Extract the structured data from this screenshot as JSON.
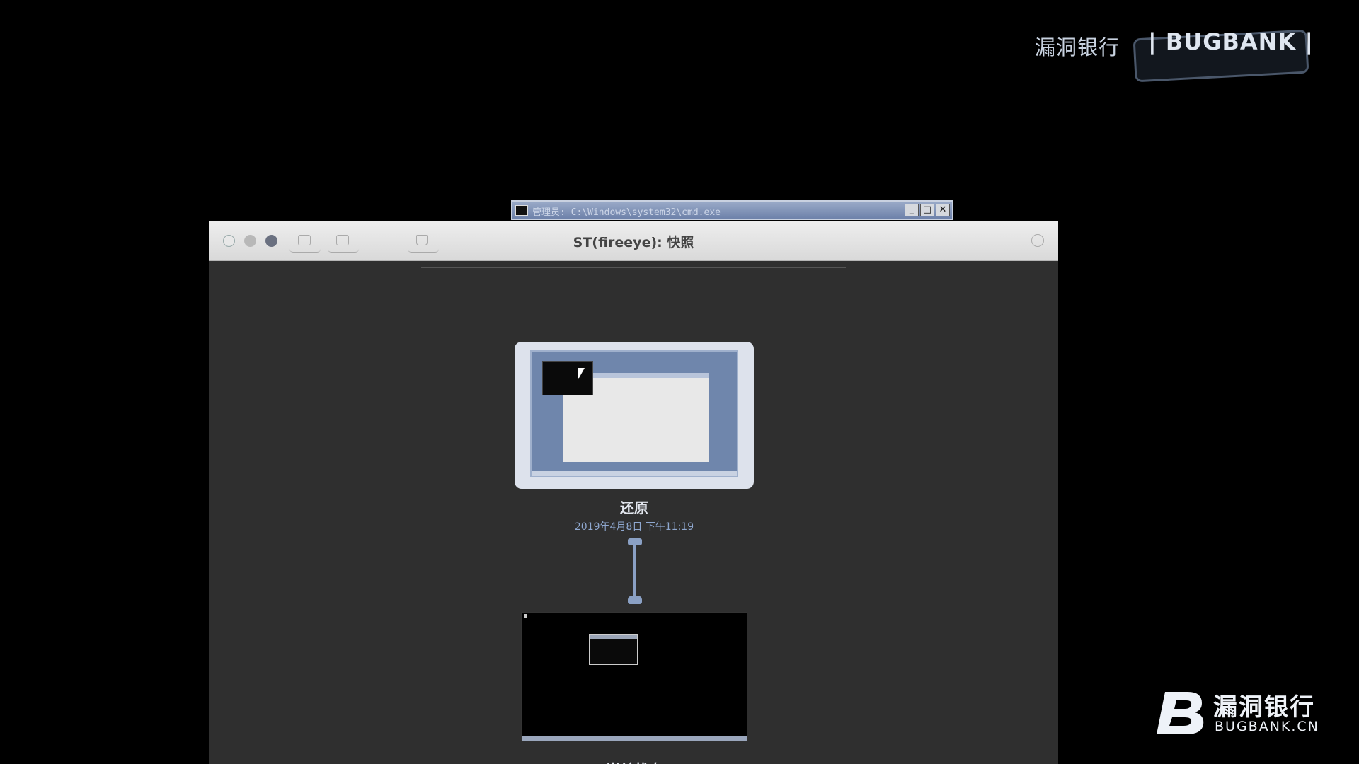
{
  "watermark_top": {
    "chinese": "漏洞银行",
    "english": "| BUGBANK |"
  },
  "terminal_window": {
    "title": "管理员: C:\\Windows\\system32\\cmd.exe",
    "minimize": "_",
    "maximize": "□",
    "close": "✕"
  },
  "window": {
    "title": "ST(fireeye): 快照",
    "toolbar": {
      "take_snapshot_icon": "camera-icon",
      "clone_icon": "clone-icon",
      "delete_icon": "trash-icon",
      "info_icon": "info-icon"
    }
  },
  "snapshot": {
    "name": "还原",
    "date": "2019年4月8日 下午11:19"
  },
  "current_state": {
    "name": "当前状态"
  },
  "logo": {
    "chinese": "漏洞银行",
    "english": "BUGBANK.CN"
  },
  "colors": {
    "accent": "#8aa0c4",
    "window_bg": "#2f2f2f",
    "titlebar": "#e4e4e4"
  }
}
